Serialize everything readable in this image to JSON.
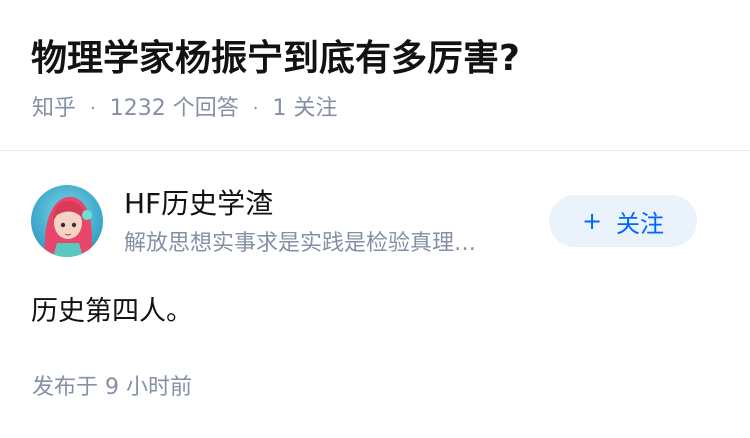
{
  "question": {
    "title": "物理学家杨振宁到底有多厉害?",
    "source": "知乎",
    "separator": "·",
    "answer_count": "1232 个回答",
    "follow_count": "1 关注"
  },
  "answer": {
    "author_name": "HF历史学渣",
    "author_bio": "解放思想实事求是实践是检验真理…",
    "follow_plus": "+",
    "follow_label": "关注",
    "content": "历史第四人。",
    "published_time": "发布于 9 小时前"
  },
  "colors": {
    "primary_text": "#121212",
    "secondary_text": "#8590a6",
    "accent": "#0066ff",
    "follow_button_bg": "#eaf2fb"
  },
  "icons": {
    "avatar": "user-avatar-illustration"
  }
}
